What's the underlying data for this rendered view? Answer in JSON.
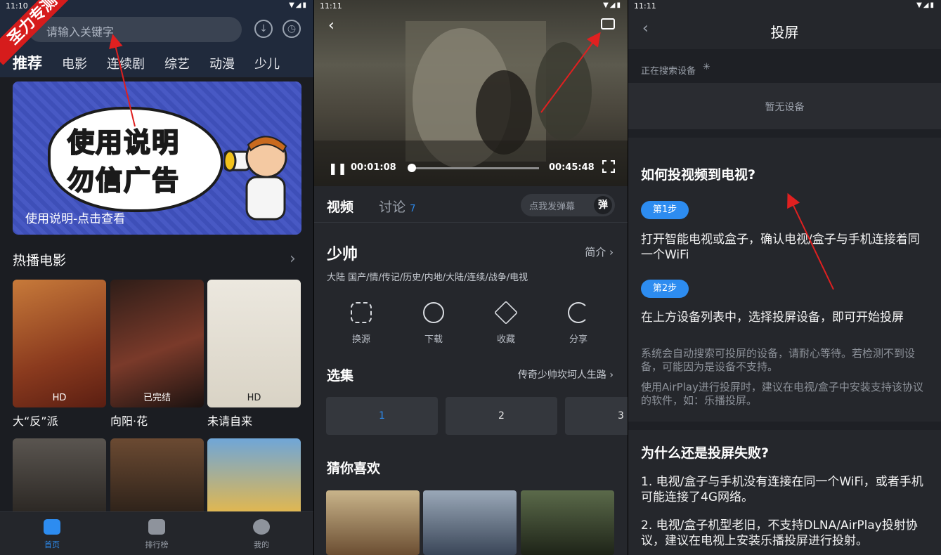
{
  "screen1": {
    "status_time": "11:10",
    "watermark": "圣力专测",
    "search_placeholder": "请输入关键字",
    "tabs": [
      "推荐",
      "电影",
      "连续剧",
      "综艺",
      "动漫",
      "少儿"
    ],
    "banner": {
      "line1": "使用说明",
      "line2": "勿信广告",
      "caption": "使用说明-点击查看"
    },
    "section_title": "热播电影",
    "movies": [
      {
        "title": "大“反”派",
        "badge": "HD"
      },
      {
        "title": "向阳·花",
        "badge": "已完结"
      },
      {
        "title": "未请自来",
        "badge": "HD"
      }
    ],
    "nav": [
      "首页",
      "排行榜",
      "我的"
    ]
  },
  "screen2": {
    "status_time": "11:11",
    "elapsed": "00:01:08",
    "duration": "00:45:48",
    "progress": 0.025,
    "tab_video": "视频",
    "tab_discuss": "讨论",
    "discuss_count": "7",
    "danmu_placeholder": "点我发弹幕",
    "danmu_btn": "弹",
    "title": "少帅",
    "intro": "简介",
    "genre": "大陆 国产/情/传记/历史/内地/大陆/连续/战争/电视",
    "actions": [
      "换源",
      "下载",
      "收藏",
      "分享"
    ],
    "episodes_title": "选集",
    "episodes_sub": "传奇少帅坎坷人生路",
    "episodes": [
      "1",
      "2",
      "3"
    ],
    "guess_title": "猜你喜欢"
  },
  "screen3": {
    "status_time": "11:11",
    "title": "投屏",
    "searching": "正在搜索设备",
    "no_device": "暂无设备",
    "q1": "如何投视频到电视?",
    "step1": "第1步",
    "step1_text": "打开智能电视或盒子，确认电视/盒子与手机连接着同一个WiFi",
    "step2": "第2步",
    "step2_text": "在上方设备列表中，选择投屏设备，即可开始投屏",
    "note1": "系统会自动搜索可投屏的设备，请耐心等待。若检测不到设备，可能因为是设备不支持。",
    "note2": "使用AirPlay进行投屏时，建议在电视/盒子中安装支持该协议的软件，如：乐播投屏。",
    "q2": "为什么还是投屏失败?",
    "reason1": "1. 电视/盒子与手机没有连接在同一个WiFi，或者手机可能连接了4G网络。",
    "reason2": "2. 电视/盒子机型老旧，不支持DLNA/AirPlay投射协议，建议在电视上安装乐播投屏进行投射。"
  },
  "colors": {
    "accent": "#2d8cf0",
    "annotation_arrow": "#e02020",
    "watermark": "#d61c1c"
  }
}
